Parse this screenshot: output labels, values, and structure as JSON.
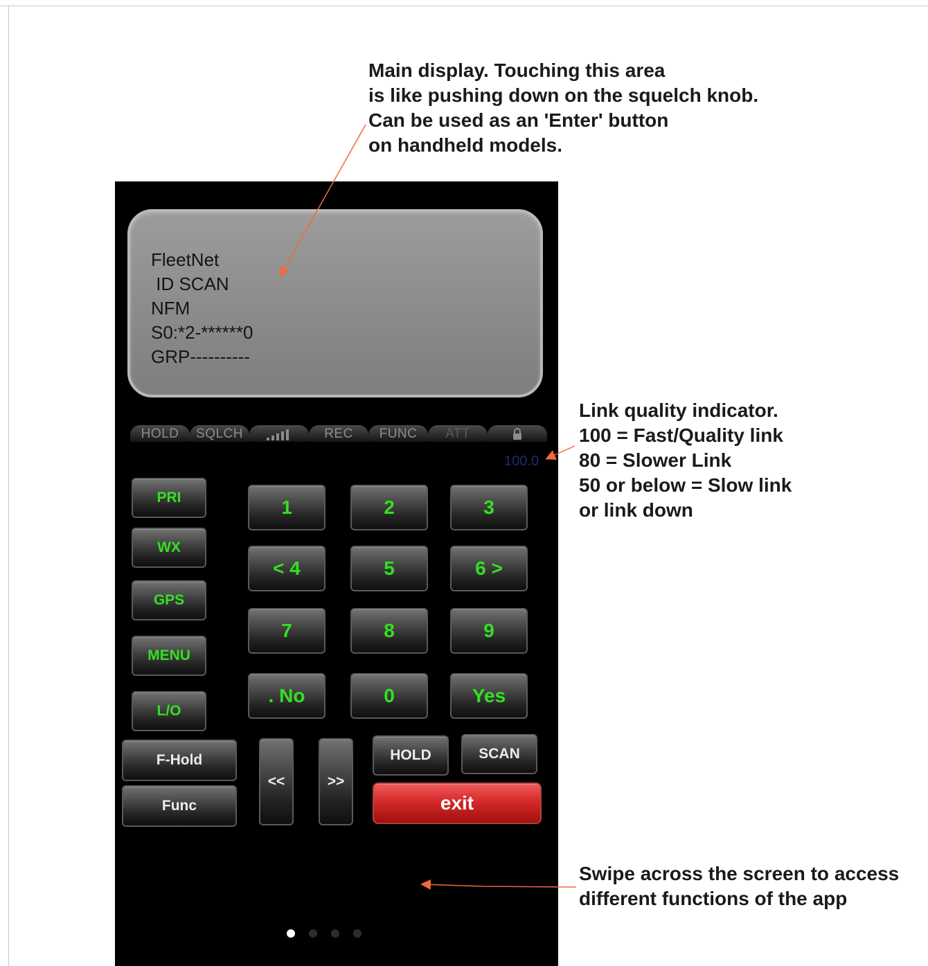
{
  "annotations": {
    "main_display": [
      "Main display. Touching this area",
      "is like pushing down on the squelch knob.",
      "Can be used as an 'Enter' button",
      "on handheld models."
    ],
    "link_quality": [
      "Link quality indicator.",
      "100 = Fast/Quality link",
      "80 = Slower Link",
      "50 or below = Slow link",
      "or link down"
    ],
    "swipe": [
      "Swipe across the screen to access",
      "different functions of the app"
    ]
  },
  "display": {
    "lines": [
      "FleetNet",
      " ID SCAN",
      "NFM",
      "S0:*2-******0",
      "GRP----------"
    ]
  },
  "indicators": {
    "hold": "HOLD",
    "sqlch": "SQLCH",
    "signal_icon": "signal-bars-icon",
    "rec": "REC",
    "func": "FUNC",
    "att": "ATT",
    "lock_icon": "lock-icon"
  },
  "link_value": "100.0",
  "side_buttons": {
    "pri": "PRI",
    "wx": "WX",
    "gps": "GPS",
    "menu": "MENU",
    "lo": "L/O"
  },
  "keypad": {
    "k1": "1",
    "k2": "2",
    "k3": "3",
    "k4": "< 4",
    "k5": "5",
    "k6": "6 >",
    "k7": "7",
    "k8": "8",
    "k9": "9",
    "kdot": ". No",
    "k0": "0",
    "kyes": "Yes"
  },
  "bottom_buttons": {
    "f_hold": "F-Hold",
    "func": "Func",
    "prev": "<<",
    "next": ">>",
    "hold": "HOLD",
    "scan": "SCAN",
    "exit": "exit"
  },
  "pager": {
    "pages": 4,
    "active": 1
  },
  "colors": {
    "key_text": "#33e023",
    "exit_button": "#d42a2a",
    "lcd": "#8b8b8b",
    "annotation_arrow": "#f06a3a"
  }
}
